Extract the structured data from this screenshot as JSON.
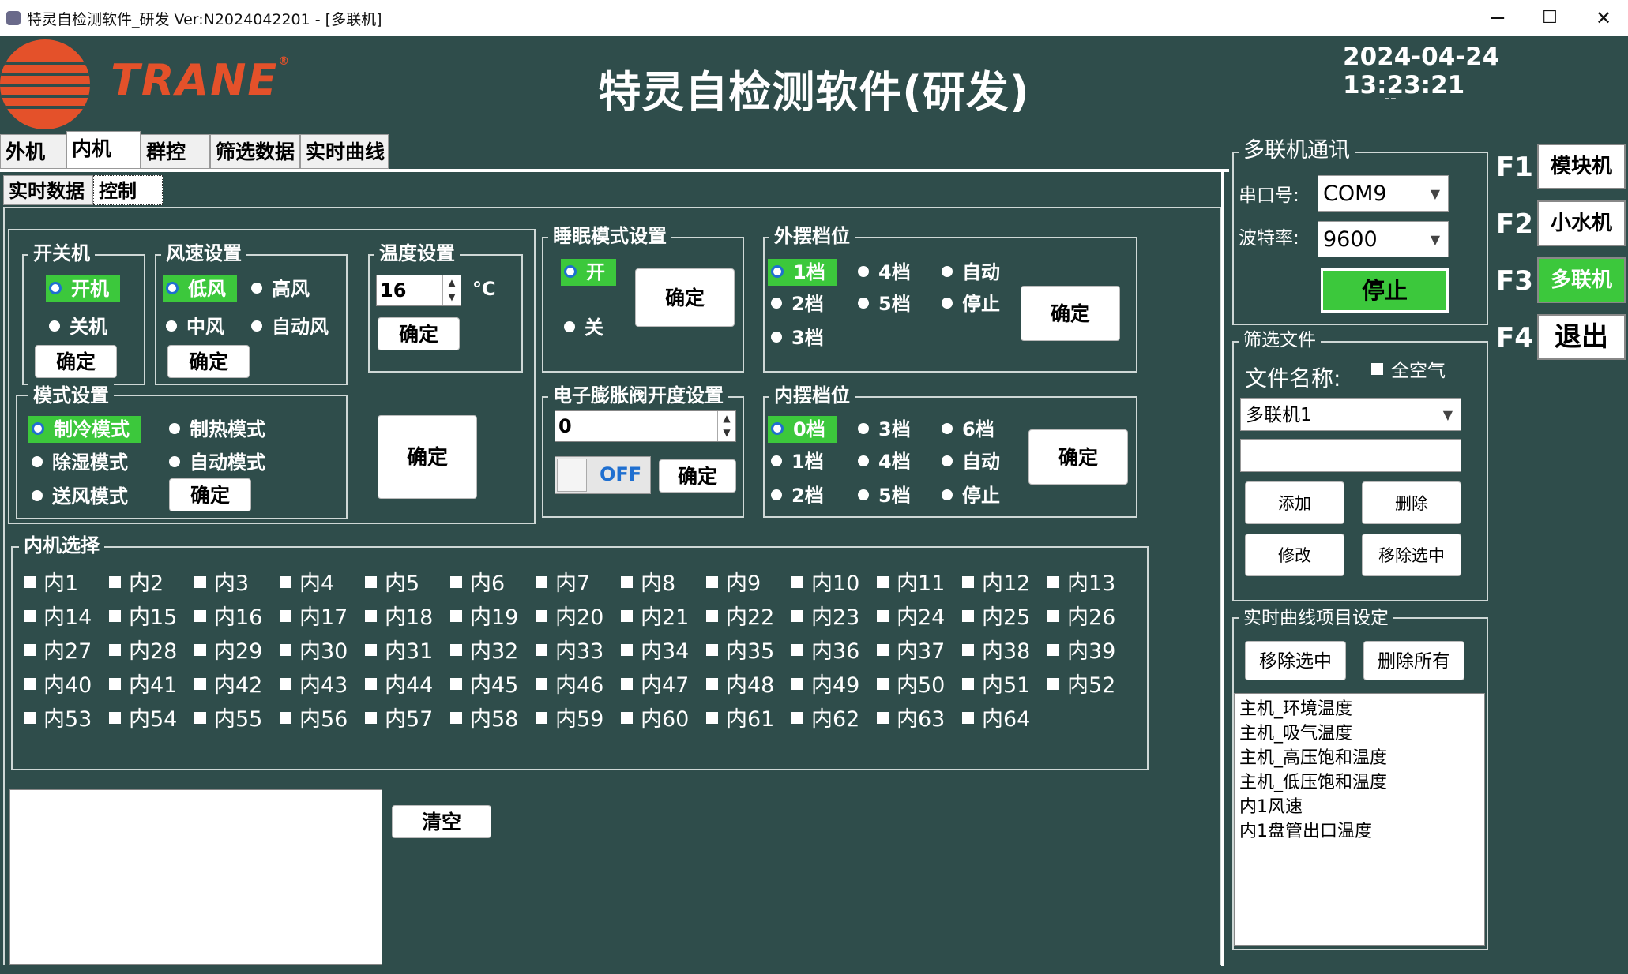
{
  "window": {
    "title": "特灵自检测软件_研发 Ver:N2024042201 - [多联机]",
    "minimize": "−",
    "maximize": "☐",
    "close": "✕"
  },
  "header": {
    "logo_text": "TRANE",
    "logo_mark": "®",
    "title": "特灵自检测软件(研发)",
    "datetime": "2024-04-24 13:23:21",
    "status": "--"
  },
  "tabs": [
    {
      "label": "外机"
    },
    {
      "label": "内机"
    },
    {
      "label": "群控"
    },
    {
      "label": "筛选数据"
    },
    {
      "label": "实时曲线"
    }
  ],
  "subtabs": [
    {
      "label": "实时数据"
    },
    {
      "label": "控制"
    }
  ],
  "power": {
    "title": "开关机",
    "on": "开机",
    "off": "关机",
    "confirm": "确定"
  },
  "fan": {
    "title": "风速设置",
    "low": "低风",
    "high": "高风",
    "mid": "中风",
    "auto": "自动风",
    "confirm": "确定"
  },
  "temp": {
    "title": "温度设置",
    "value": "16",
    "unit": "°C",
    "confirm": "确定"
  },
  "mode": {
    "title": "模式设置",
    "cool": "制冷模式",
    "heat": "制热模式",
    "dry": "除湿模式",
    "auto": "自动模式",
    "fan": "送风模式",
    "confirm": "确定"
  },
  "big_confirm": "确定",
  "sleep": {
    "title": "睡眠模式设置",
    "on": "开",
    "off": "关",
    "confirm": "确定"
  },
  "outer_swing": {
    "title": "外摆档位",
    "options": [
      "1档",
      "4档",
      "自动",
      "2档",
      "5档",
      "停止",
      "3档"
    ],
    "confirm": "确定"
  },
  "eev": {
    "title": "电子膨胀阀开度设置",
    "value": "0",
    "toggle": "OFF",
    "confirm": "确定"
  },
  "inner_swing": {
    "title": "内摆档位",
    "options": [
      "0档",
      "3档",
      "6档",
      "1档",
      "4档",
      "自动",
      "2档",
      "5档",
      "停止"
    ],
    "confirm": "确定"
  },
  "indoor_select": {
    "title": "内机选择",
    "units": [
      "内1",
      "内2",
      "内3",
      "内4",
      "内5",
      "内6",
      "内7",
      "内8",
      "内9",
      "内10",
      "内11",
      "内12",
      "内13",
      "内14",
      "内15",
      "内16",
      "内17",
      "内18",
      "内19",
      "内20",
      "内21",
      "内22",
      "内23",
      "内24",
      "内25",
      "内26",
      "内27",
      "内28",
      "内29",
      "内30",
      "内31",
      "内32",
      "内33",
      "内34",
      "内35",
      "内36",
      "内37",
      "内38",
      "内39",
      "内40",
      "内41",
      "内42",
      "内43",
      "内44",
      "内45",
      "内46",
      "内47",
      "内48",
      "内49",
      "内50",
      "内51",
      "内52",
      "内53",
      "内54",
      "内55",
      "内56",
      "内57",
      "内58",
      "内59",
      "内60",
      "内61",
      "内62",
      "内63",
      "内64"
    ]
  },
  "log": {
    "clear": "清空"
  },
  "comm": {
    "title": "多联机通讯",
    "port_label": "串口号:",
    "port": "COM9",
    "baud_label": "波特率:",
    "baud": "9600",
    "stop": "停止"
  },
  "filter": {
    "title": "筛选文件",
    "name_label": "文件名称:",
    "all_air": "全空气",
    "file": "多联机1",
    "input": "",
    "add": "添加",
    "delete": "删除",
    "modify": "修改",
    "remove_sel": "移除选中"
  },
  "curve": {
    "title": "实时曲线项目设定",
    "remove_sel": "移除选中",
    "remove_all": "删除所有",
    "items": [
      "主机_环境温度",
      "主机_吸气温度",
      "主机_高压饱和温度",
      "主机_低压饱和温度",
      "内1风速",
      "内1盘管出口温度"
    ]
  },
  "fkeys": [
    {
      "key": "F1",
      "label": "模块机"
    },
    {
      "key": "F2",
      "label": "小水机"
    },
    {
      "key": "F3",
      "label": "多联机"
    },
    {
      "key": "F4",
      "label": "退出"
    }
  ]
}
